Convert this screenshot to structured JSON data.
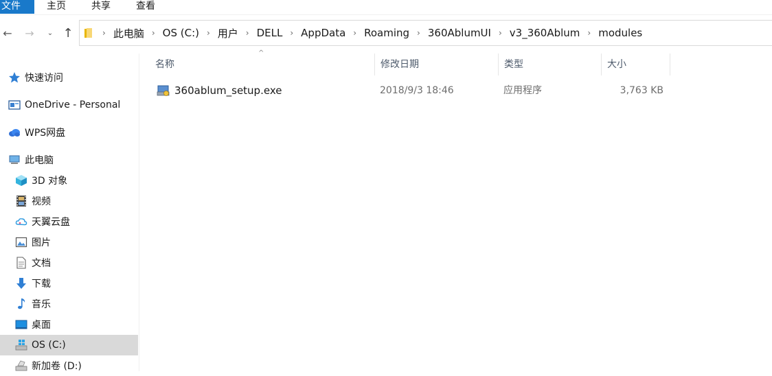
{
  "ribbon": {
    "tabs": [
      "文件",
      "主页",
      "共享",
      "查看"
    ]
  },
  "nav": {
    "back": "←",
    "forward": "→",
    "recent": "⌄",
    "up": "↑"
  },
  "address": {
    "crumbs": [
      "此电脑",
      "OS (C:)",
      "用户",
      "DELL",
      "AppData",
      "Roaming",
      "360AblumUI",
      "v3_360Ablum",
      "modules"
    ],
    "separator": "›"
  },
  "sidebar": {
    "items": [
      {
        "label": "快速访问",
        "icon": "star-icon"
      },
      {
        "label": "OneDrive - Personal",
        "icon": "onedrive-icon"
      },
      {
        "label": "WPS网盘",
        "icon": "cloud-icon"
      },
      {
        "label": "此电脑",
        "icon": "computer-icon"
      },
      {
        "label": "3D 对象",
        "icon": "cube-icon"
      },
      {
        "label": "视频",
        "icon": "film-icon"
      },
      {
        "label": "天翼云盘",
        "icon": "tianyi-cloud-icon"
      },
      {
        "label": "图片",
        "icon": "picture-icon"
      },
      {
        "label": "文档",
        "icon": "document-icon"
      },
      {
        "label": "下载",
        "icon": "download-arrow-icon"
      },
      {
        "label": "音乐",
        "icon": "music-note-icon"
      },
      {
        "label": "桌面",
        "icon": "desktop-icon"
      },
      {
        "label": "OS (C:)",
        "icon": "windows-drive-icon"
      },
      {
        "label": "新加卷 (D:)",
        "icon": "drive-icon"
      }
    ]
  },
  "columns": {
    "name": "名称",
    "date": "修改日期",
    "type": "类型",
    "size": "大小",
    "sort_indicator": "^"
  },
  "files": [
    {
      "name": "360ablum_setup.exe",
      "date": "2018/9/3 18:46",
      "type": "应用程序",
      "size": "3,763 KB",
      "icon": "installer-icon"
    }
  ],
  "colors": {
    "accent": "#1979ca",
    "selection": "#d9d9d9",
    "header_text": "#4d5a6b"
  }
}
